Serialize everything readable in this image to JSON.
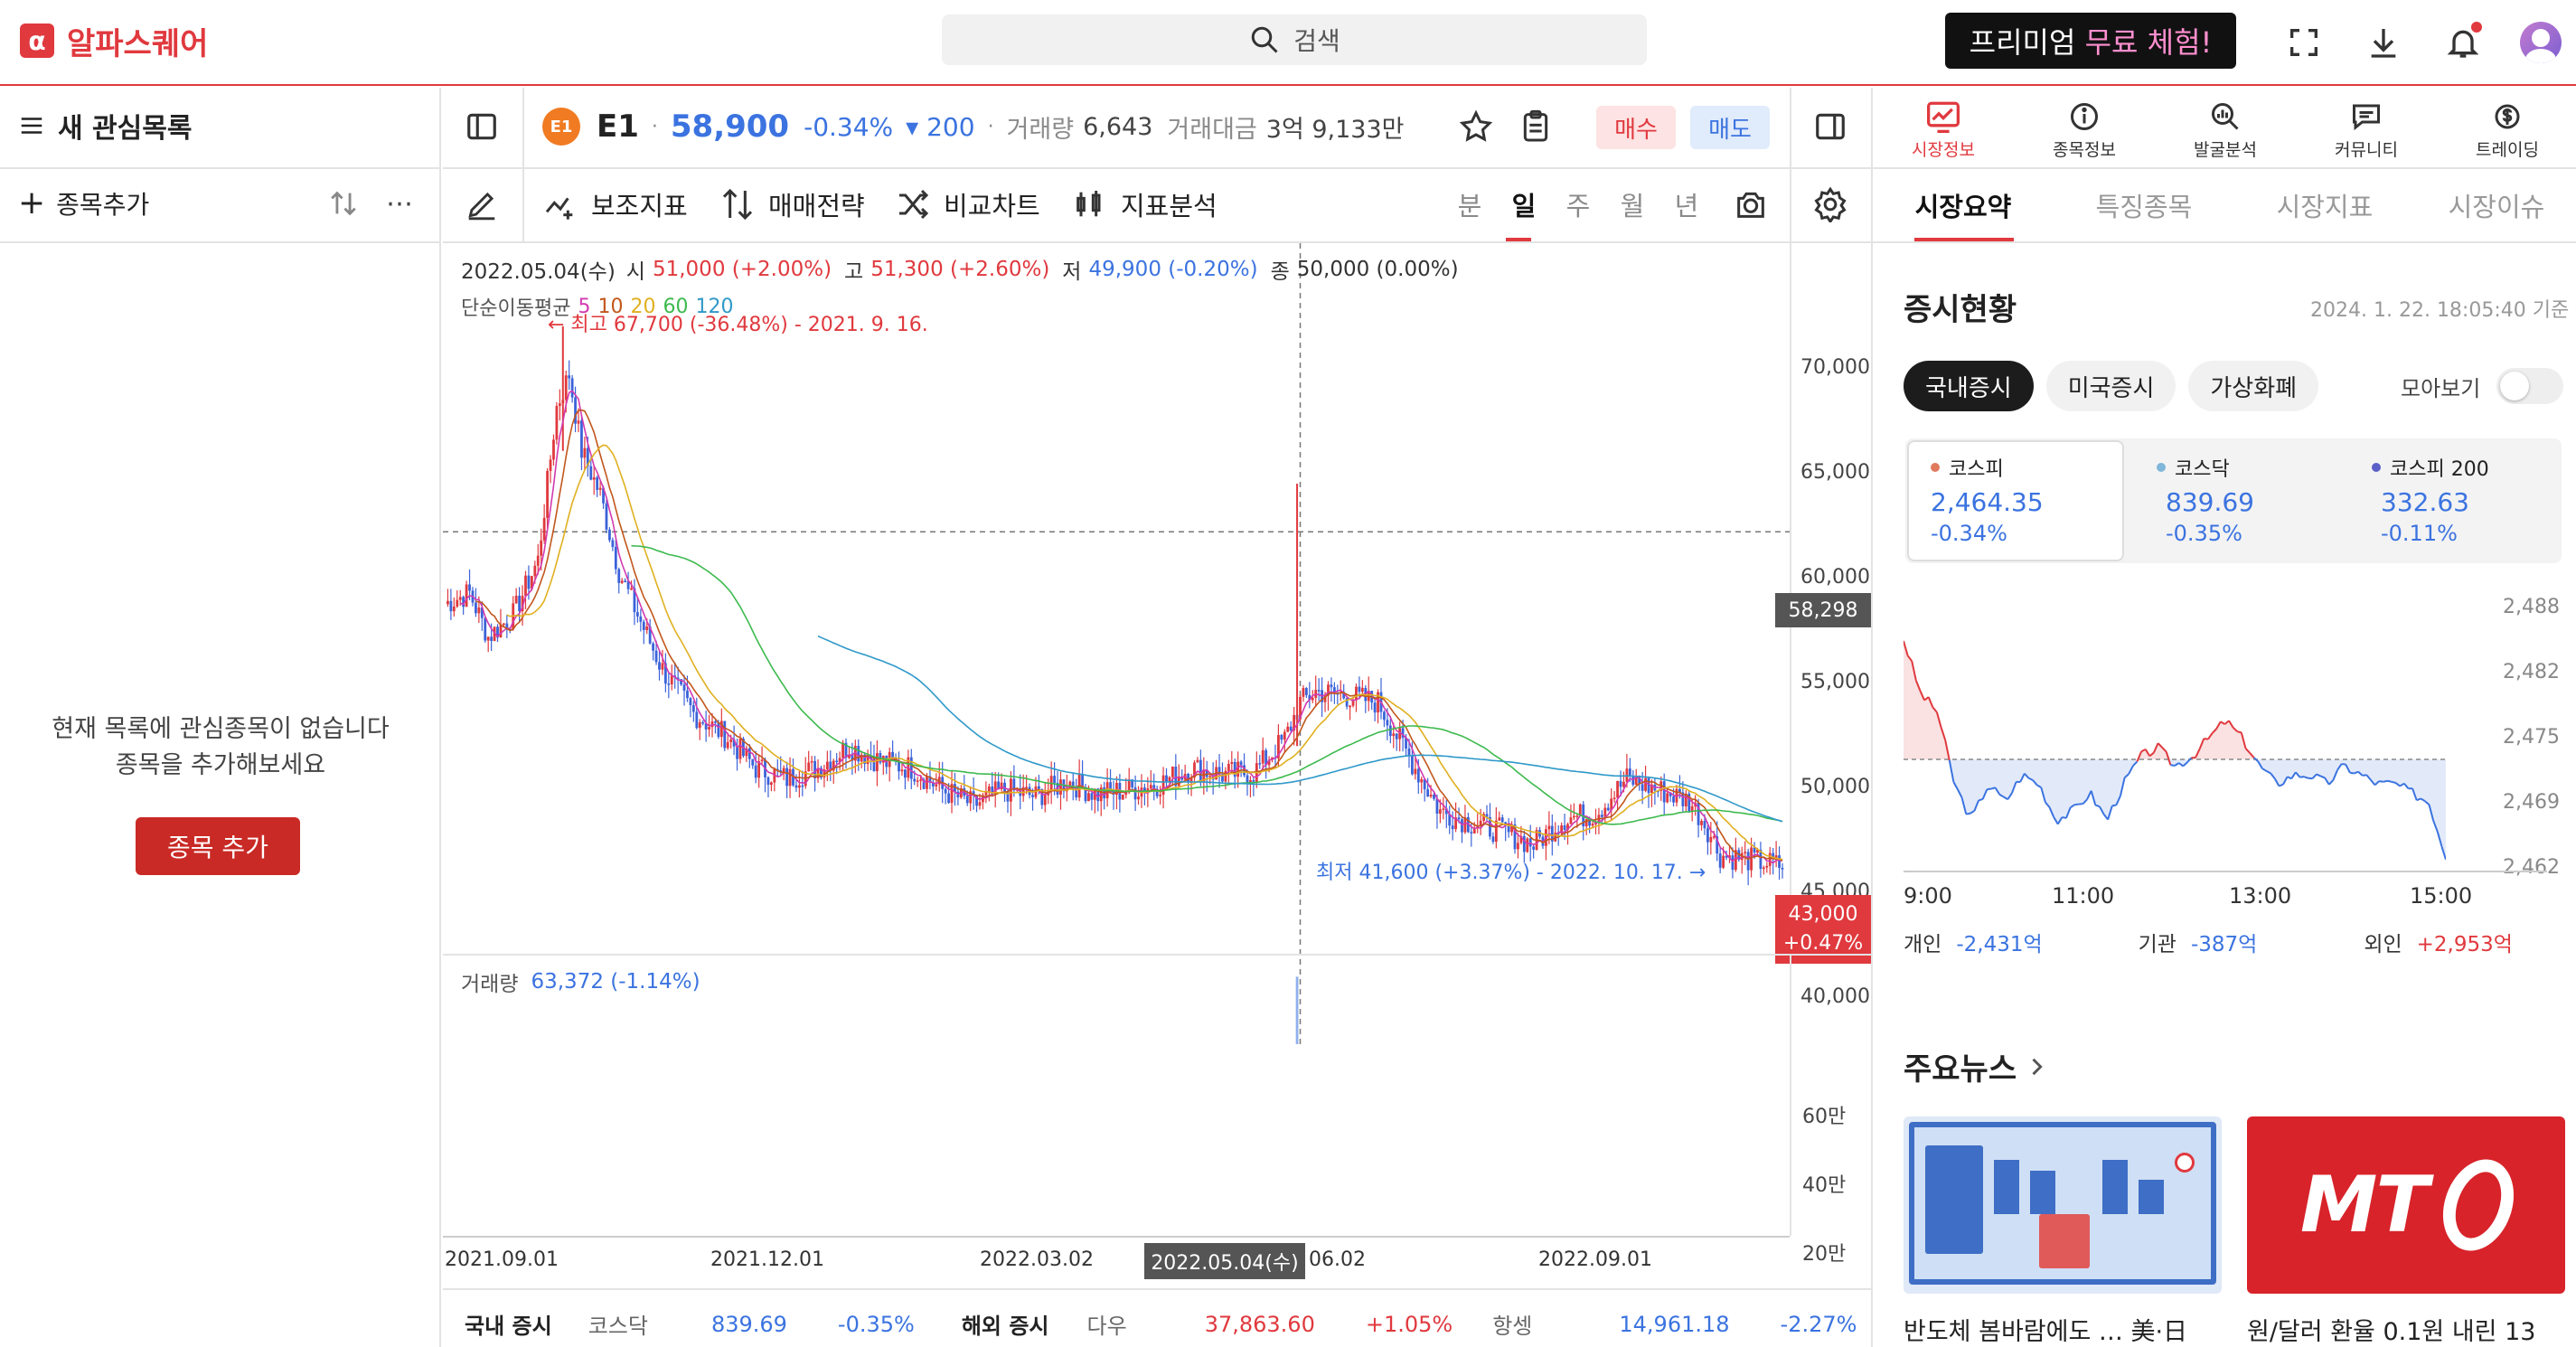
{
  "header": {
    "logo_text": "알파스퀘어",
    "search_placeholder": "검색",
    "premium_prefix": "프리미엄 ",
    "premium_highlight": "무료 체험!"
  },
  "watchlist": {
    "title": "새 관심목록",
    "add_label": "종목추가",
    "empty_line1": "현재 목록에 관심종목이 없습니다",
    "empty_line2": "종목을 추가해보세요",
    "add_button": "종목 추가"
  },
  "stock": {
    "name": "E1",
    "price": "58,900",
    "change_pct": "-0.34%",
    "change_abs": "▾ 200",
    "volume_label": "거래량",
    "volume": "6,643",
    "amount_label": "거래대금",
    "amount": "3억 9,133만",
    "buy": "매수",
    "sell": "매도"
  },
  "toolbar": {
    "indicator": "보조지표",
    "strategy": "매매전략",
    "compare": "비교차트",
    "analysis": "지표분석",
    "periods": [
      "분",
      "일",
      "주",
      "월",
      "년"
    ],
    "active_period": "일"
  },
  "chart_info": {
    "date": "2022.05.04(수)",
    "open_label": "시",
    "open": "51,000 (+2.00%)",
    "high_label": "고",
    "high": "51,300 (+2.60%)",
    "low_label": "저",
    "low": "49,900 (-0.20%)",
    "close_label": "종",
    "close": "50,000 (0.00%)",
    "ma_label": "단순이동평균",
    "ma_periods": [
      "5",
      "10",
      "20",
      "60",
      "120"
    ],
    "max_annotation": "← 최고 67,700 (-36.48%) - 2021. 9. 16.",
    "min_annotation": "최저 41,600 (+3.37%) - 2022. 10. 17. →",
    "crosshair_price": "58,298",
    "current_price": "43,000",
    "current_change": "+0.47%",
    "volume_label": "거래량",
    "volume_value": "63,372 (-1.14%)",
    "crosshair_date": "2022.05.04(수)"
  },
  "chart_data": {
    "type": "candlestick",
    "price_axis": [
      "70,000",
      "65,000",
      "60,000",
      "55,000",
      "50,000",
      "45,000",
      "40,000"
    ],
    "ylim": [
      39000,
      71500
    ],
    "volume_axis": [
      "60만",
      "40만",
      "20만"
    ],
    "x_labels": [
      "2021.09.01",
      "2021.12.01",
      "2022.03.02",
      "06.02",
      "2022.09.01"
    ],
    "close_path": [
      [
        0,
        55000
      ],
      [
        8,
        55500
      ],
      [
        14,
        53500
      ],
      [
        22,
        54500
      ],
      [
        30,
        57000
      ],
      [
        36,
        64000
      ],
      [
        40,
        65500
      ],
      [
        44,
        62000
      ],
      [
        50,
        60000
      ],
      [
        56,
        56500
      ],
      [
        62,
        54500
      ],
      [
        70,
        52000
      ],
      [
        80,
        50000
      ],
      [
        90,
        49000
      ],
      [
        100,
        47500
      ],
      [
        110,
        47000
      ],
      [
        120,
        47500
      ],
      [
        130,
        48500
      ],
      [
        140,
        47800
      ],
      [
        150,
        47500
      ],
      [
        160,
        46500
      ],
      [
        170,
        45800
      ],
      [
        180,
        46500
      ],
      [
        190,
        46200
      ],
      [
        200,
        46900
      ],
      [
        210,
        46300
      ],
      [
        220,
        46500
      ],
      [
        230,
        46800
      ],
      [
        240,
        47500
      ],
      [
        250,
        47200
      ],
      [
        260,
        47300
      ],
      [
        270,
        48800
      ],
      [
        275,
        50500
      ],
      [
        280,
        51000
      ],
      [
        290,
        50800
      ],
      [
        300,
        50500
      ],
      [
        310,
        48000
      ],
      [
        320,
        45500
      ],
      [
        330,
        45000
      ],
      [
        340,
        44600
      ],
      [
        350,
        44000
      ],
      [
        360,
        45200
      ],
      [
        370,
        45400
      ],
      [
        380,
        47000
      ],
      [
        390,
        46500
      ],
      [
        400,
        46000
      ],
      [
        405,
        45000
      ],
      [
        410,
        43500
      ],
      [
        420,
        43300
      ],
      [
        430,
        43000
      ]
    ],
    "ma_colors": [
      "#d23ab0",
      "#c2571c",
      "#e0b020",
      "#3dba4e",
      "#2f99c9"
    ],
    "kr_indices_label": "국내 증시"
  },
  "footer_ticker": {
    "domestic_label": "국내 증시",
    "kosdaq_name": "코스닥",
    "kosdaq_value": "839.69",
    "kosdaq_change": "-0.35%",
    "overseas_label": "해외 증시",
    "dow_name": "다우",
    "dow_value": "37,863.60",
    "dow_change": "+1.05%",
    "hs_name": "항셍",
    "hs_value": "14,961.18",
    "hs_change": "-2.27%"
  },
  "right_nav": {
    "items": [
      "시장정보",
      "종목정보",
      "발굴분석",
      "커뮤니티",
      "트레이딩"
    ],
    "tabs": [
      "시장요약",
      "특징종목",
      "시장지표",
      "시장이슈"
    ]
  },
  "market": {
    "title": "증시현황",
    "timestamp": "2024. 1. 22. 18:05:40 기준",
    "segments": [
      "국내증시",
      "미국증시",
      "가상화폐"
    ],
    "toggle_label": "모아보기",
    "indices": [
      {
        "name": "코스피",
        "value": "2,464.35",
        "change": "-0.34%",
        "dot": "#e07a5f"
      },
      {
        "name": "코스닥",
        "value": "839.69",
        "change": "-0.35%",
        "dot": "#7fb6d9"
      },
      {
        "name": "코스피 200",
        "value": "332.63",
        "change": "-0.11%",
        "dot": "#5b5fc7"
      }
    ],
    "mini_axis": [
      "2,488",
      "2,482",
      "2,475",
      "2,469",
      "2,462"
    ],
    "mini_x": [
      "9:00",
      "11:00",
      "13:00",
      "15:00"
    ],
    "investors": [
      {
        "label": "개인",
        "value": "-2,431억",
        "color": "#3b73e0"
      },
      {
        "label": "기관",
        "value": "-387억",
        "color": "#3b73e0"
      },
      {
        "label": "외인",
        "value": "+2,953억",
        "color": "#e0393e"
      }
    ]
  },
  "news": {
    "title": "주요뉴스",
    "items": [
      {
        "title": "반도체 봄바람에도 … 美·日"
      },
      {
        "title": "원/달러 환율 0.1원 내린 13"
      }
    ],
    "mt_logo": "MT"
  }
}
